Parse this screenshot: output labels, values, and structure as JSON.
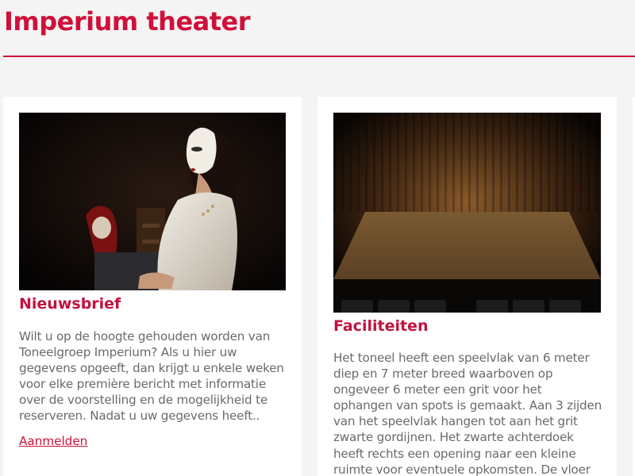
{
  "header": {
    "title": "Imperium theater"
  },
  "cards": [
    {
      "heading": "Nieuwsbrief",
      "image": "performer-white-mask-photo",
      "body": "Wilt u op de hoogte gehouden worden van Toneelgroep Imperium? Als u hier uw gegevens opgeeft, dan krijgt u enkele weken voor elke première bericht met informatie over de voorstelling en de mogelijkheid te reserveren. Nadat u uw gegevens heeft..",
      "link": "Aanmelden"
    },
    {
      "heading": "Faciliteiten",
      "image": "empty-stage-photo",
      "body": "Het toneel heeft een speelvlak van 6 meter diep en 7 meter breed waarboven op ongeveer 6 meter een grit voor het ophangen van spots is gemaakt. Aan 3 zijden van het speelvlak hangen tot aan het grit zwarte gordijnen. Het zwarte achterdoek heeft rechts een opening naar een kleine ruimte voor eventuele opkomsten. De vloer is standaard"
    }
  ],
  "colors": {
    "accent": "#d0103a",
    "background": "#f4f4f4",
    "card": "#ffffff",
    "text": "#6a6a6a"
  }
}
